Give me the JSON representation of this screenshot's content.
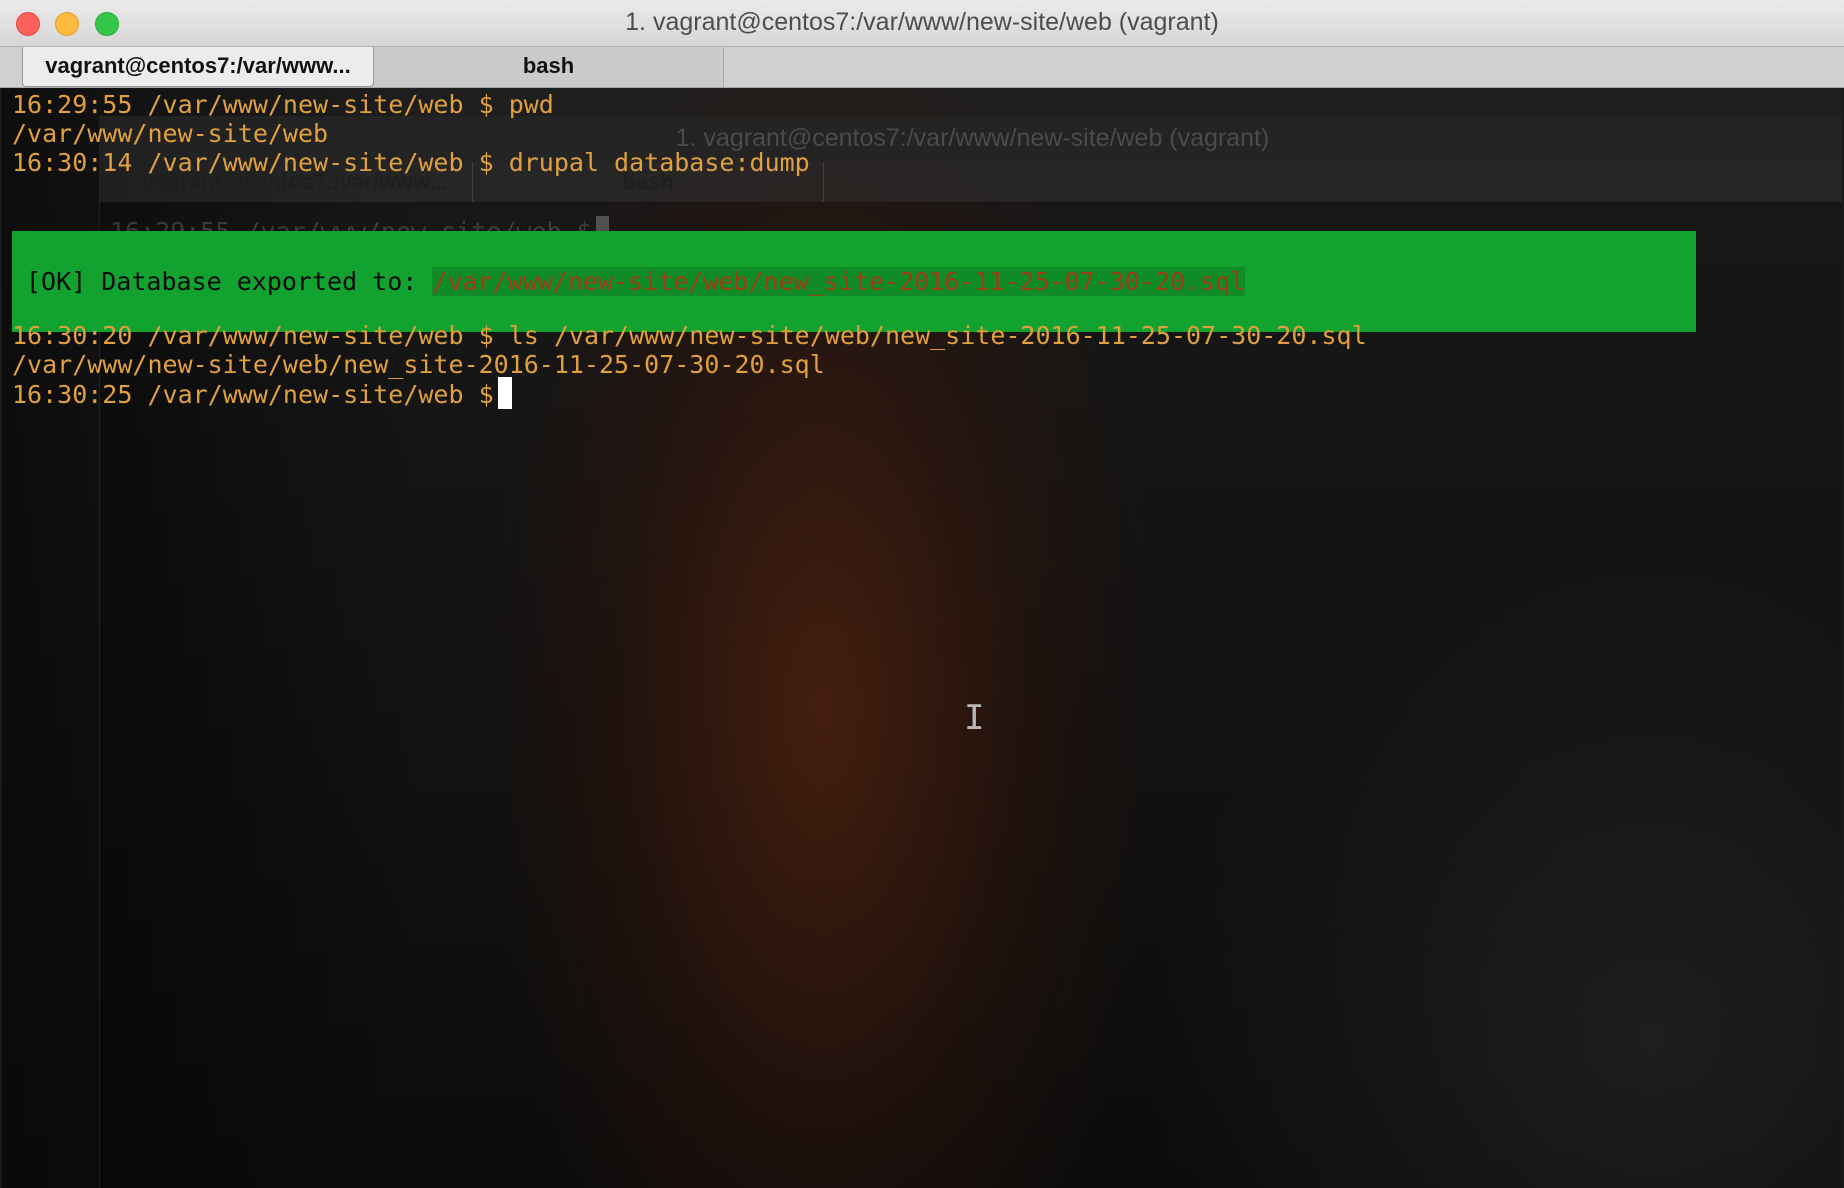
{
  "window": {
    "title": "1. vagrant@centos7:/var/www/new-site/web (vagrant)"
  },
  "tabs": [
    {
      "label": "vagrant@centos7:/var/www...",
      "active": true
    },
    {
      "label": "bash",
      "active": false
    }
  ],
  "ghost": {
    "title": "1. vagrant@centos7:/var/www/new-site/web (vagrant)",
    "tab1": "vagrant@centos7:/var/www...",
    "tab2": "bash",
    "line": "16:29:55 /var/www/new-site/web $"
  },
  "terminal": {
    "lines": [
      "16:29:55 /var/www/new-site/web $ pwd",
      "/var/www/new-site/web",
      "16:30:14 /var/www/new-site/web $ drupal database:dump"
    ],
    "ok_message": {
      "prefix": "[OK] Database exported to: ",
      "path": "/var/www/new-site/web/new_site-2016-11-25-07-30-20.sql"
    },
    "lines_after": [
      "16:30:20 /var/www/new-site/web $ ls /var/www/new-site/web/new_site-2016-11-25-07-30-20.sql",
      "/var/www/new-site/web/new_site-2016-11-25-07-30-20.sql",
      "16:30:25 /var/www/new-site/web $"
    ]
  },
  "colors": {
    "prompt_text": "#e0a040",
    "ok_background": "#12a22f",
    "ok_path": "#9f3d12",
    "cursor": "#ffffff"
  }
}
